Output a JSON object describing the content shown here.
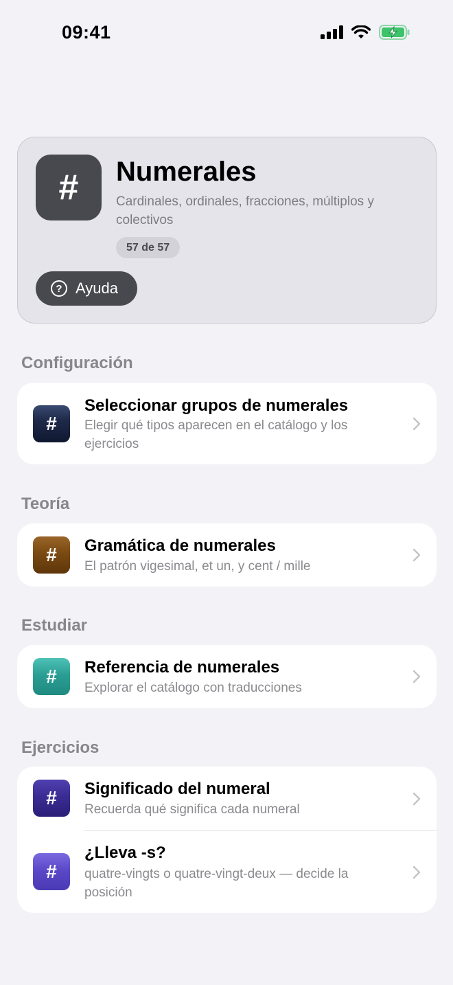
{
  "status": {
    "time": "09:41"
  },
  "hero": {
    "icon_glyph": "#",
    "title": "Numerales",
    "subtitle": "Cardinales, ordinales, fracciones, múltiplos y colectivos",
    "badge": "57 de 57",
    "help_icon_glyph": "?",
    "help_label": "Ayuda"
  },
  "sections": {
    "config": {
      "label": "Configuración",
      "items": [
        {
          "glyph": "#",
          "title": "Seleccionar grupos de numerales",
          "subtitle": "Elegir qué tipos aparecen en el catálogo y los ejercicios",
          "color": "#1f2a4a"
        }
      ]
    },
    "theory": {
      "label": "Teoría",
      "items": [
        {
          "glyph": "#",
          "title": "Gramática de numerales",
          "subtitle": "El patrón vigesimal, et un, y cent / mille",
          "color": "#7a4a12"
        }
      ]
    },
    "study": {
      "label": "Estudiar",
      "items": [
        {
          "glyph": "#",
          "title": "Referencia de numerales",
          "subtitle": "Explorar el catálogo con traducciones",
          "color": "#2b9e94"
        }
      ]
    },
    "exercises": {
      "label": "Ejercicios",
      "items": [
        {
          "glyph": "#",
          "title": "Significado del numeral",
          "subtitle": "Recuerda qué significa cada numeral",
          "color": "#3a2c93"
        },
        {
          "glyph": "#",
          "title": "¿Lleva -s?",
          "subtitle": "quatre-vingts o quatre-vingt-deux — decide la posición",
          "color": "#5a49c8"
        }
      ]
    }
  }
}
